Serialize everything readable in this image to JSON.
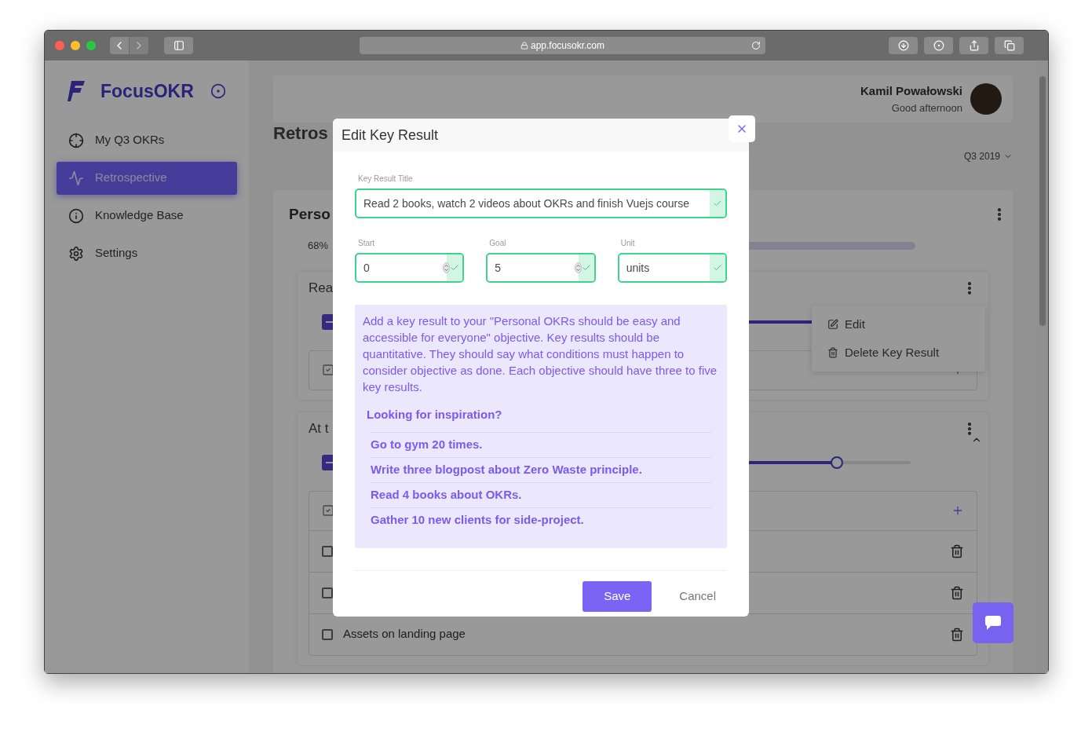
{
  "browser": {
    "url": "app.focusokr.com"
  },
  "sidebar": {
    "logo": "FocusOKR",
    "items": [
      {
        "label": "My Q3 OKRs",
        "selected": false
      },
      {
        "label": "Retrospective",
        "selected": true
      },
      {
        "label": "Knowledge Base",
        "selected": false
      },
      {
        "label": "Settings",
        "selected": false
      }
    ]
  },
  "header": {
    "user_name": "Kamil Powałowski",
    "greeting": "Good afternoon"
  },
  "page_title": "Retros",
  "period": "Q3 2019",
  "objective": {
    "title": "Perso",
    "progress": "68%"
  },
  "key_results": [
    {
      "title": "Rea",
      "kind": "bar",
      "level": 0.9
    },
    {
      "title": "At t",
      "kind": "slider",
      "level": 0.87,
      "tasks": [
        {
          "checked": false
        },
        {
          "checked": false
        },
        {
          "label": "Assets on landing page",
          "checked": false
        }
      ]
    }
  ],
  "menu": {
    "items": [
      {
        "label": "Edit"
      },
      {
        "label": "Delete Key Result"
      }
    ]
  },
  "modal": {
    "title": "Edit Key Result",
    "title_field": {
      "label": "Key Result Title",
      "value": "Read 2 books, watch 2 videos about OKRs and finish Vuejs course",
      "valid": true
    },
    "fields": [
      {
        "label": "Start",
        "value": "0",
        "kind": "number",
        "valid": true
      },
      {
        "label": "Goal",
        "value": "5",
        "kind": "number",
        "valid": true
      },
      {
        "label": "Unit",
        "value": "units",
        "kind": "text",
        "valid": true
      }
    ],
    "info": {
      "text": "Add a key result to your \"Personal OKRs should be easy and accessible for everyone\" objective. Key results should be quantitative. They should say what conditions must happen to consider objective as done. Each objective should have three to five key results.",
      "heading": "Looking for inspiration?",
      "suggestions": [
        "Go to gym 20 times.",
        "Write three blogpost about Zero Waste principle.",
        "Read 4 books about OKRs.",
        "Gather 10 new clients for side-project."
      ]
    },
    "save": "Save",
    "cancel": "Cancel"
  }
}
